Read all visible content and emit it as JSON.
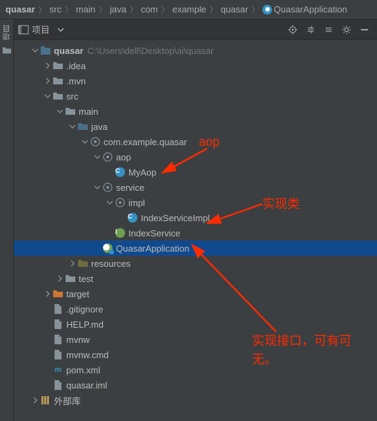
{
  "breadcrumb": [
    "quasar",
    "src",
    "main",
    "java",
    "com",
    "example",
    "quasar",
    "QuasarApplication"
  ],
  "toolwindow": {
    "side_label": "项目",
    "title": "项目"
  },
  "project_root": {
    "name": "quasar",
    "path": "C:\\Users\\dell\\Desktop\\ai\\quasar"
  },
  "tree": [
    {
      "d": 0,
      "exp": "open",
      "ico": "module",
      "label": "quasar",
      "bold": true,
      "hint": "C:\\Users\\dell\\Desktop\\ai\\quasar"
    },
    {
      "d": 1,
      "exp": "closed",
      "ico": "folder",
      "label": ".idea"
    },
    {
      "d": 1,
      "exp": "closed",
      "ico": "folder",
      "label": ".mvn"
    },
    {
      "d": 1,
      "exp": "open",
      "ico": "folder",
      "label": "src"
    },
    {
      "d": 2,
      "exp": "open",
      "ico": "folder",
      "label": "main"
    },
    {
      "d": 3,
      "exp": "open",
      "ico": "folder-src",
      "label": "java"
    },
    {
      "d": 4,
      "exp": "open",
      "ico": "package",
      "label": "com.example.quasar"
    },
    {
      "d": 5,
      "exp": "open",
      "ico": "package",
      "label": "aop"
    },
    {
      "d": 6,
      "exp": "none",
      "ico": "class",
      "label": "MyAop"
    },
    {
      "d": 5,
      "exp": "open",
      "ico": "package",
      "label": "service"
    },
    {
      "d": 6,
      "exp": "open",
      "ico": "package",
      "label": "impl"
    },
    {
      "d": 7,
      "exp": "none",
      "ico": "class",
      "label": "IndexServiceImpl"
    },
    {
      "d": 6,
      "exp": "none",
      "ico": "interface",
      "label": "IndexService"
    },
    {
      "d": 5,
      "exp": "none",
      "ico": "springboot",
      "label": "QuasarApplication",
      "selected": true
    },
    {
      "d": 3,
      "exp": "closed",
      "ico": "folder-res",
      "label": "resources"
    },
    {
      "d": 2,
      "exp": "closed",
      "ico": "folder",
      "label": "test"
    },
    {
      "d": 1,
      "exp": "closed",
      "ico": "folder-out",
      "label": "target"
    },
    {
      "d": 1,
      "exp": "none",
      "ico": "file",
      "label": ".gitignore"
    },
    {
      "d": 1,
      "exp": "none",
      "ico": "file",
      "label": "HELP.md"
    },
    {
      "d": 1,
      "exp": "none",
      "ico": "file",
      "label": "mvnw"
    },
    {
      "d": 1,
      "exp": "none",
      "ico": "file",
      "label": "mvnw.cmd"
    },
    {
      "d": 1,
      "exp": "none",
      "ico": "maven",
      "label": "pom.xml"
    },
    {
      "d": 1,
      "exp": "none",
      "ico": "file",
      "label": "quasar.iml"
    },
    {
      "d": 0,
      "exp": "closed",
      "ico": "lib",
      "label": "外部库"
    }
  ],
  "annotations": {
    "text1": "aop",
    "text2": "实现类",
    "text3": "实现接口，可有可无。"
  }
}
